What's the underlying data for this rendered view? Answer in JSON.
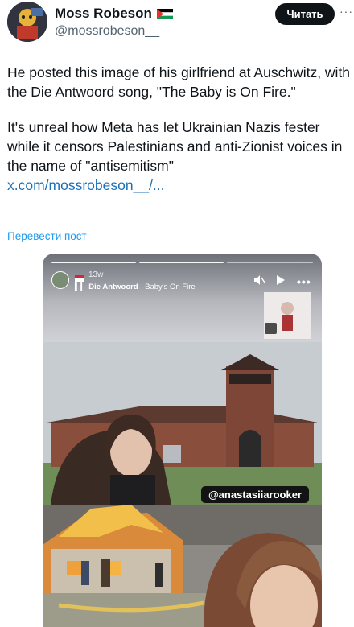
{
  "author": {
    "name": "Moss Robeson",
    "handle": "@mossrobeson__",
    "follow_label": "Читать"
  },
  "post": {
    "paragraph1": "He posted this image of his girlfriend at Auschwitz, with the Die Antwoord song, \"The Baby is On Fire.\"",
    "paragraph2": "It's unreal how Meta has let Ukrainian Nazis fester while it censors Palestinians and anti-Zionist voices in the name of \"antisemitism\"",
    "link": "x.com/mossrobeson__/...",
    "translate_label": "Перевести пост"
  },
  "story": {
    "time": "13w",
    "artist": "Die Antwoord",
    "song": "· Baby's On Fire",
    "handle_tag": "@anastasiiarooker"
  },
  "icons": [
    "more-icon",
    "flag-icon",
    "mute-icon",
    "play-icon",
    "more-dots-icon",
    "music-bars-icon"
  ]
}
